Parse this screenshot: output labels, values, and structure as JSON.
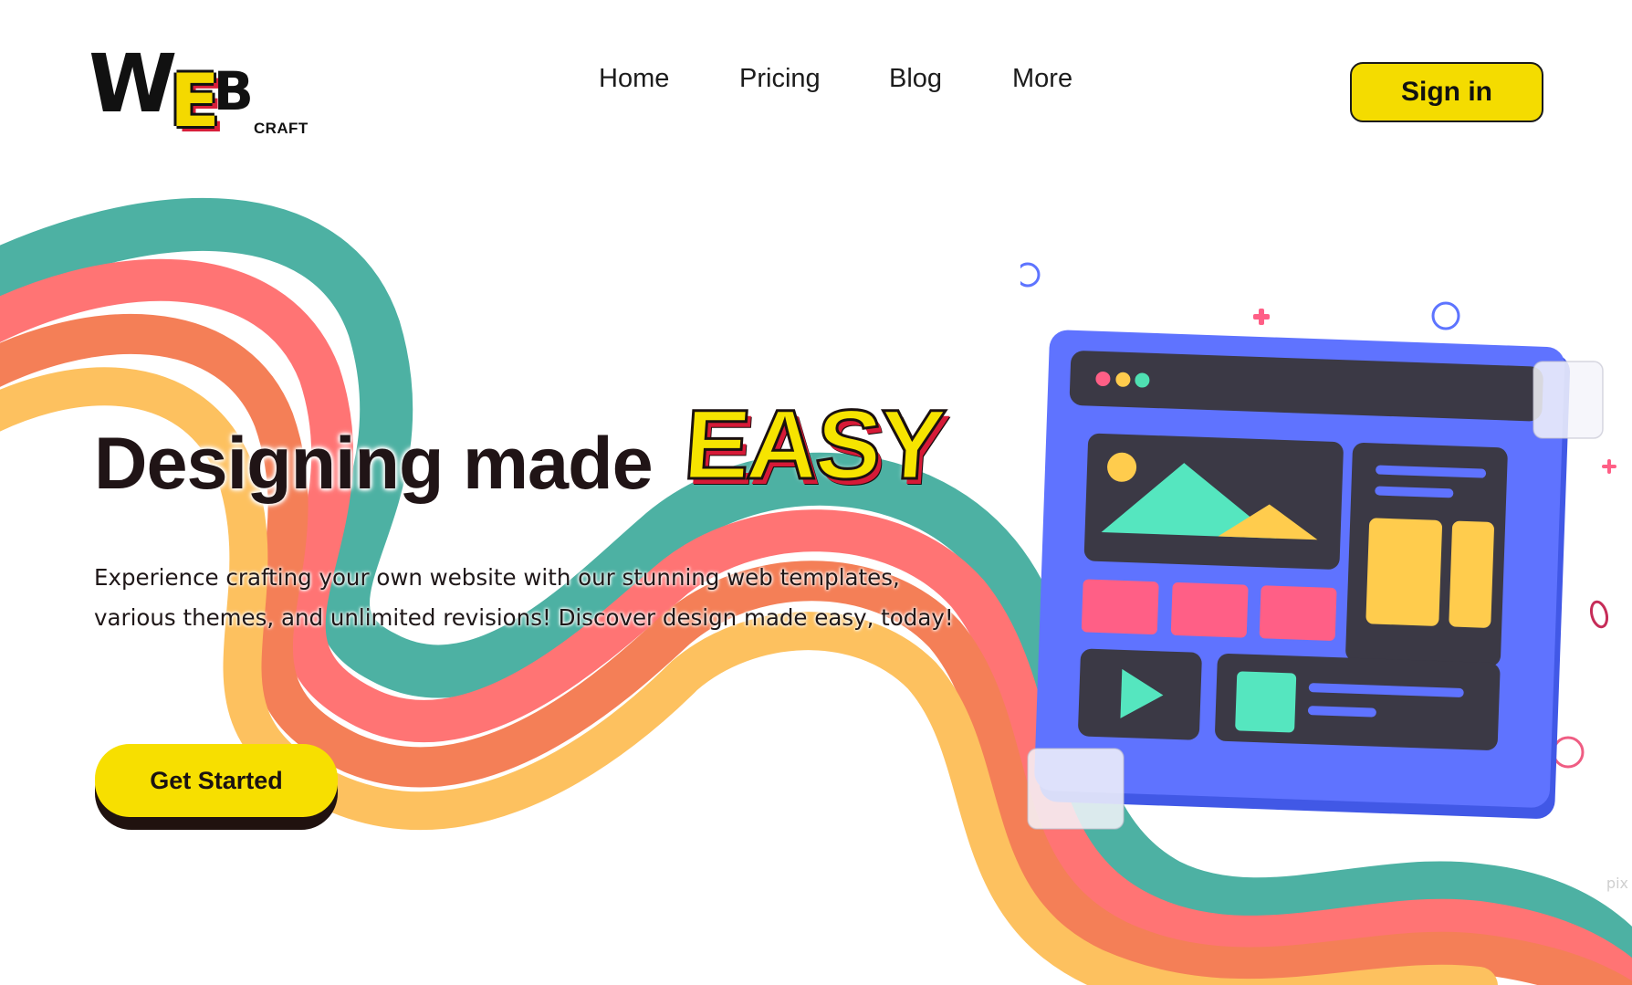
{
  "brand": {
    "logo_word_w": "W",
    "logo_word_e": "E",
    "logo_word_b": "B",
    "logo_sub": "CRAFT"
  },
  "nav": {
    "items": [
      {
        "label": "Home"
      },
      {
        "label": "Pricing"
      },
      {
        "label": "Blog"
      },
      {
        "label": "More"
      }
    ]
  },
  "header": {
    "signin_label": "Sign in"
  },
  "hero": {
    "title_plain": "Designing made ",
    "title_highlight": "EASY",
    "description_line1": "Experience crafting your own website with our stunning web templates,",
    "description_line2": "various themes, and unlimited revisions! Discover design made easy, today!",
    "cta_label": "Get Started"
  },
  "colors": {
    "accent_yellow": "#f4dc00",
    "ribbon_teal": "#4db1a3",
    "ribbon_coral": "#ff7474",
    "ribbon_orange": "#f47f57",
    "ribbon_gold": "#fdc15f",
    "illustration_blue": "#5f73ff",
    "dark_panel": "#3b3945",
    "text_dark": "#201416"
  },
  "icons": {
    "browser_dots": "window-controls-icon",
    "image": "image-placeholder-icon",
    "play": "play-icon",
    "plus": "plus-icon",
    "circle": "circle-icon"
  },
  "watermark": {
    "label": "pix"
  }
}
